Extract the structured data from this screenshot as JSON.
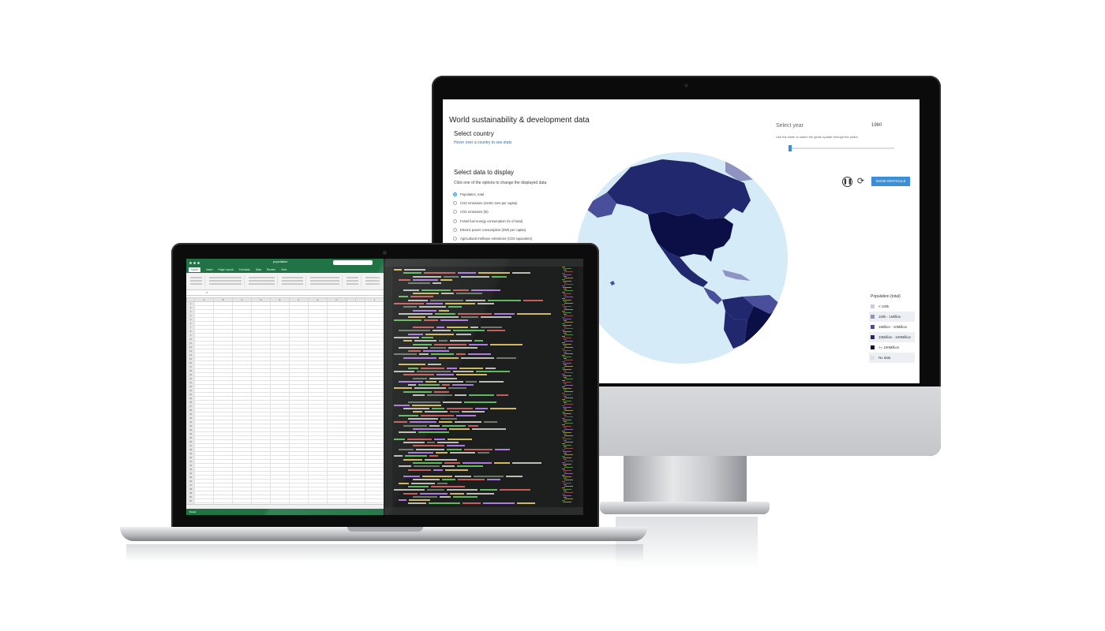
{
  "web_app": {
    "title": "World sustainability & development data",
    "select_country": "Select country",
    "country_hint": "Hover over a country to see stats",
    "select_data": "Select data to display",
    "data_hint": "Click one of the options to change the displayed data",
    "options": [
      {
        "label": "Population, total",
        "checked": true
      },
      {
        "label": "CO2 emissions (metric tons per capita)",
        "checked": false
      },
      {
        "label": "CO2 emissions (kt)",
        "checked": false
      },
      {
        "label": "Fossil fuel energy consumption (% of total)",
        "checked": false
      },
      {
        "label": "Electric power consumption (kWh per capita)",
        "checked": false
      },
      {
        "label": "Agricultural methane emissions (CO2 equivalent)",
        "checked": false
      }
    ],
    "select_year": "Select year",
    "year": "1960",
    "year_hint": "Use the slider to watch the globe update through the years",
    "slider_fraction": 0.0,
    "pause_icon": "pause-icon",
    "refresh_icon": "refresh-icon",
    "graticule_button": "SHOW GRATICULE",
    "legend": {
      "title": "Population (total)",
      "items": [
        {
          "label": "< 100k",
          "color": "#c9cde0"
        },
        {
          "label": "100k - 1Million",
          "color": "#8f93c2"
        },
        {
          "label": "1Million - 10Million",
          "color": "#4a4f9c"
        },
        {
          "label": "10Million - 100Million",
          "color": "#22286e"
        },
        {
          "label": ">= 100Million",
          "color": "#0b0f45"
        },
        {
          "label": "No data",
          "color": "#e0e0e0"
        }
      ]
    },
    "colors": {
      "ocean": "#d5ebf7",
      "accent": "#3a8fd8"
    }
  },
  "excel": {
    "title": "population",
    "search": "",
    "tabs": [
      "Home",
      "Insert",
      "Page Layout",
      "Formulas",
      "Data",
      "Review",
      "View"
    ],
    "namebox": "",
    "formula": "",
    "columns": [
      "",
      "A",
      "B",
      "C",
      "D",
      "E",
      "F",
      "G",
      "H",
      "I",
      "J"
    ],
    "header_row": [
      "1",
      "",
      "",
      "",
      "",
      "",
      "",
      "",
      "",
      "",
      ""
    ],
    "rows": [],
    "sheets": [],
    "status": "Ready",
    "accent": "#217346"
  },
  "editor": {
    "tabs": [],
    "status": ""
  }
}
